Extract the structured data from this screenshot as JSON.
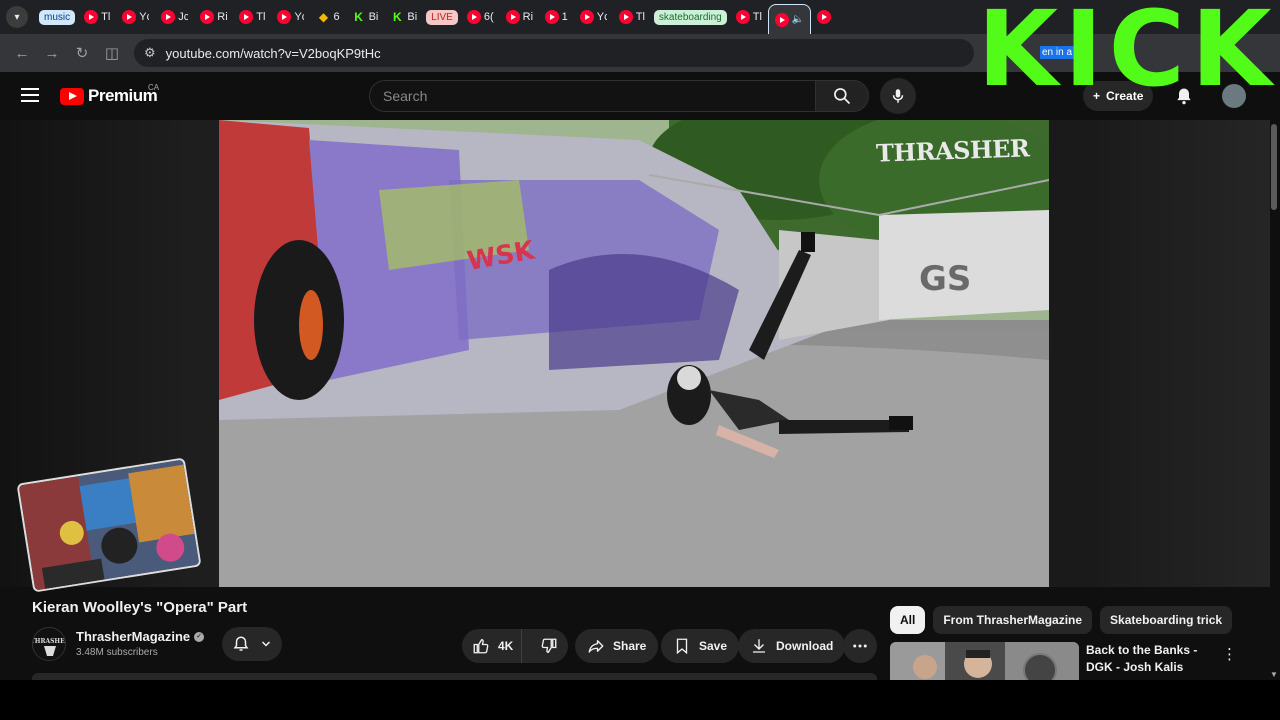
{
  "browser": {
    "tab_groups": {
      "music": "music",
      "live": "LIVE",
      "skate": "skateboarding"
    },
    "tabs": [
      {
        "text": "Tl",
        "icon": "youtube-icon"
      },
      {
        "text": "Yc",
        "icon": "youtube-icon"
      },
      {
        "text": "Jc",
        "icon": "youtube-icon"
      },
      {
        "text": "Ri",
        "icon": "youtube-icon"
      },
      {
        "text": "Tl",
        "icon": "youtube-icon"
      },
      {
        "text": "Yc",
        "icon": "youtube-icon"
      },
      {
        "text": "6",
        "icon": "binance-icon"
      },
      {
        "text": "Bi",
        "icon": "kick-icon"
      },
      {
        "text": "Bi",
        "icon": "kick-icon"
      },
      {
        "text": "6(",
        "icon": "youtube-icon"
      },
      {
        "text": "Ri",
        "icon": "youtube-icon"
      },
      {
        "text": "1",
        "icon": "youtube-icon"
      },
      {
        "text": "Yc",
        "icon": "youtube-icon"
      },
      {
        "text": "Tl",
        "icon": "youtube-icon"
      },
      {
        "text": "Tl",
        "icon": "youtube-icon"
      }
    ],
    "url": "youtube.com/watch?v=V2boqKP9tHc",
    "open_in_text": "en in a"
  },
  "overlay": {
    "kick_text": "KICK"
  },
  "header": {
    "logo_text": "Premium",
    "country": "CA",
    "search_placeholder": "Search",
    "create_label": "Create"
  },
  "video": {
    "watermark": "THRASHER",
    "title": "Kieran Woolley's \"Opera\" Part",
    "channel": "ThrasherMagazine",
    "subscribers": "3.48M subscribers",
    "likes": "4K",
    "share": "Share",
    "save": "Save",
    "download": "Download"
  },
  "sidebar": {
    "chips": [
      "All",
      "From ThrasherMagazine",
      "Skateboarding trick"
    ],
    "recommendation": {
      "title": "Back to the Banks - DGK - Josh Kalis"
    }
  },
  "colors": {
    "kick_green": "#53fc18",
    "youtube_red": "#ff0000",
    "background": "#0f0f0f"
  }
}
